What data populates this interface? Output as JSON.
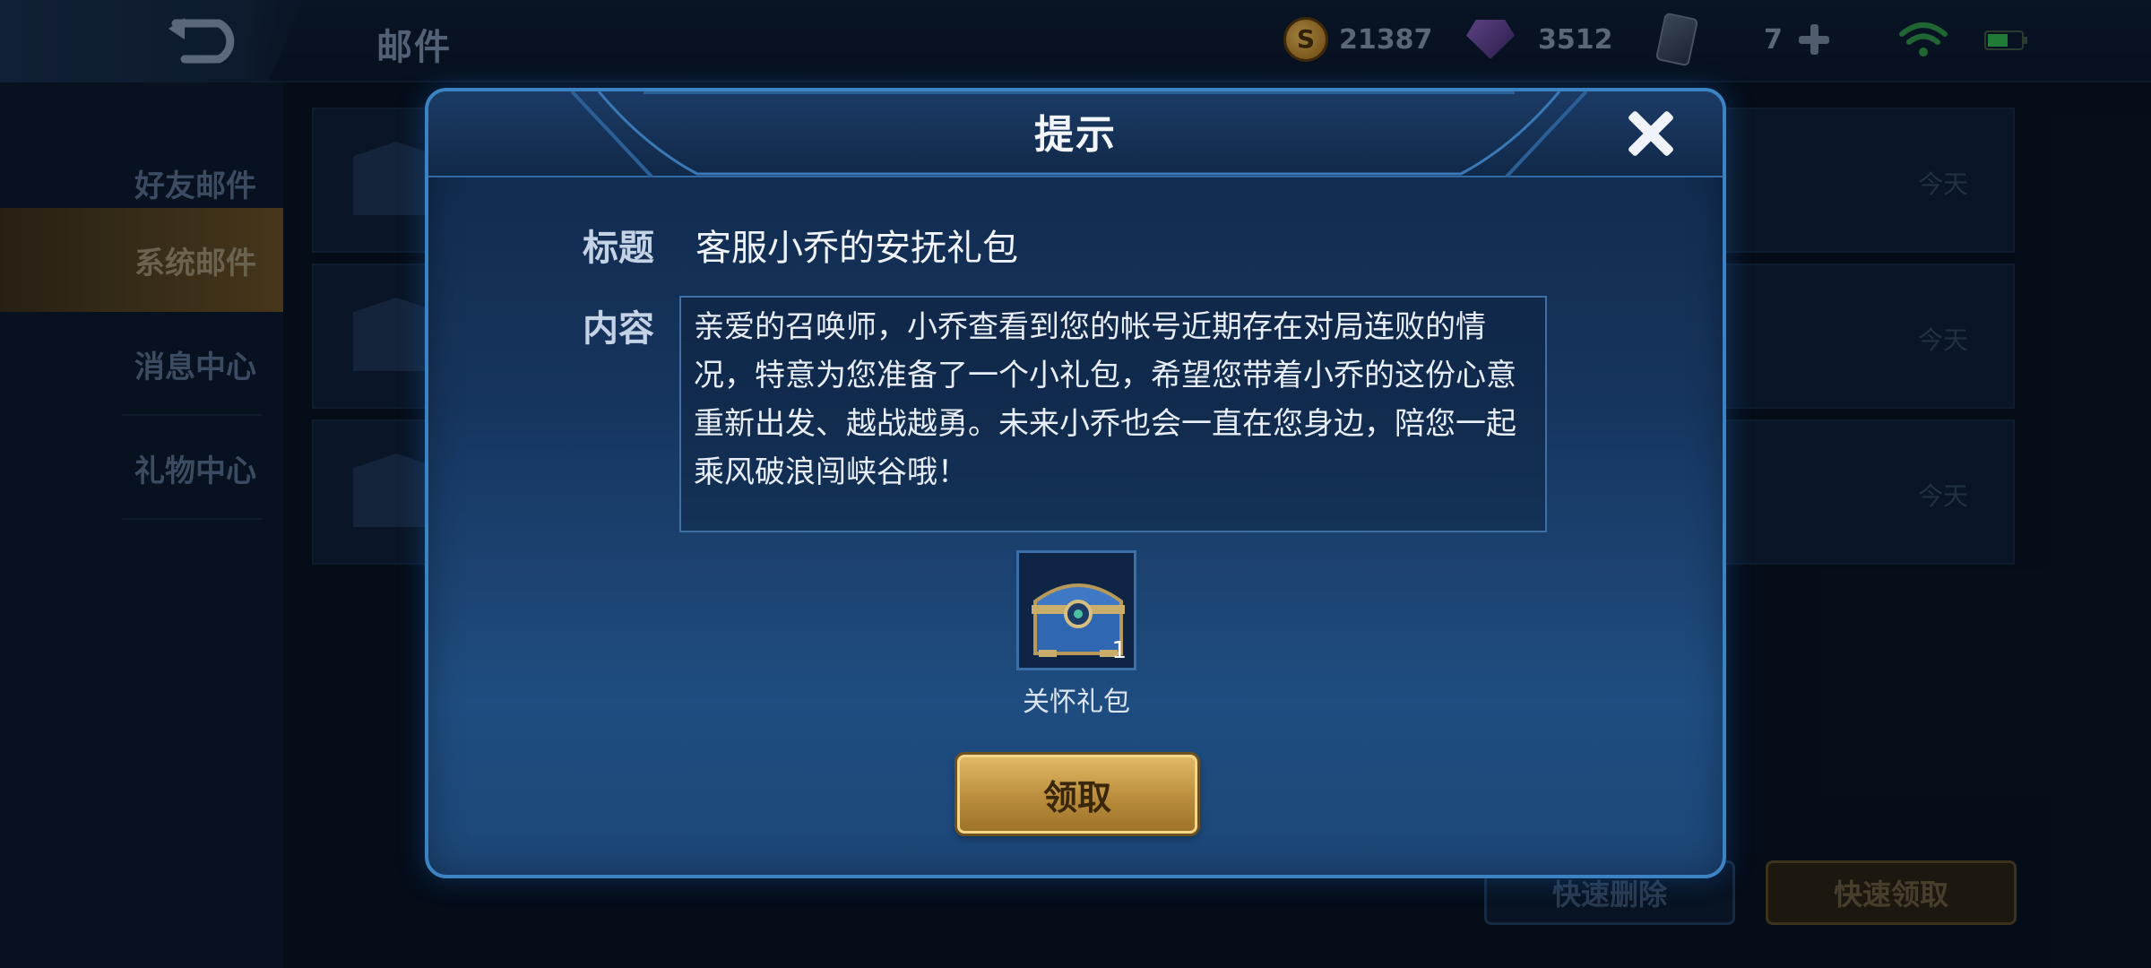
{
  "header": {
    "title": "邮件",
    "gold": "21387",
    "diamonds": "3512",
    "cards": "7"
  },
  "sidebar": {
    "items": [
      {
        "label": "好友邮件"
      },
      {
        "label": "系统邮件"
      },
      {
        "label": "消息中心"
      },
      {
        "label": "礼物中心"
      }
    ]
  },
  "mail_list": {
    "rows": [
      {
        "date": "今天"
      },
      {
        "date": "今天"
      },
      {
        "date": "今天"
      }
    ]
  },
  "actions": {
    "delete_all": "快速删除",
    "claim_all": "快速领取"
  },
  "dialog": {
    "title": "提示",
    "title_label": "标题",
    "title_value": "客服小乔的安抚礼包",
    "content_label": "内容",
    "content_value": "亲爱的召唤师，小乔查看到您的帐号近期存在对局连败的情况，特意为您准备了一个小礼包，希望您带着小乔的这份心意重新出发、越战越勇。未来小乔也会一直在您身边，陪您一起乘风破浪闯峡谷哦！",
    "item": {
      "name": "关怀礼包",
      "count": "1",
      "icon": "treasure-chest-icon"
    },
    "claim_button": "领取"
  },
  "colors": {
    "accent_blue": "#3c83c4",
    "gold_button": "#c99a47",
    "active_tab": "#6b5222"
  }
}
